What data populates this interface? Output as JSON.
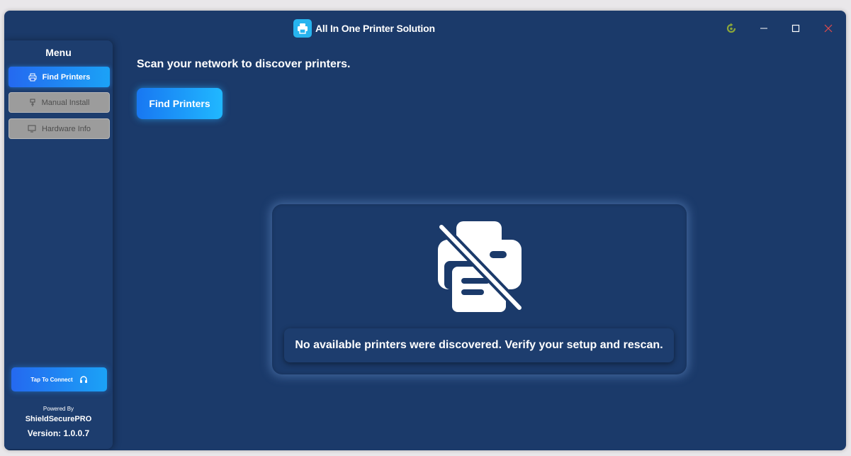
{
  "window": {
    "title": "All In One Printer Solution",
    "controls": [
      "refresh-icon",
      "minimize-icon",
      "maximize-icon",
      "close-icon"
    ]
  },
  "sidebar": {
    "menu_title": "Menu",
    "items": [
      {
        "label": "Find Printers",
        "icon": "printer-icon",
        "state": "active"
      },
      {
        "label": "Manual Install",
        "icon": "usb-icon",
        "state": "disabled"
      },
      {
        "label": "Hardware Info",
        "icon": "monitor-icon",
        "state": "disabled"
      }
    ],
    "connect_label": "Tap To Connect",
    "powered_by": "Powered By",
    "brand": "ShieldSecurePRO",
    "version": "Version: 1.0.0.7"
  },
  "main": {
    "heading": "Scan your network to discover printers.",
    "find_button": "Find Printers",
    "empty_message": "No available printers were discovered. Verify your setup and rescan."
  },
  "colors": {
    "background": "#1b3a6a",
    "accent": "#1ba2f6",
    "close": "#e24b4b",
    "refresh": "#8aa63a"
  }
}
